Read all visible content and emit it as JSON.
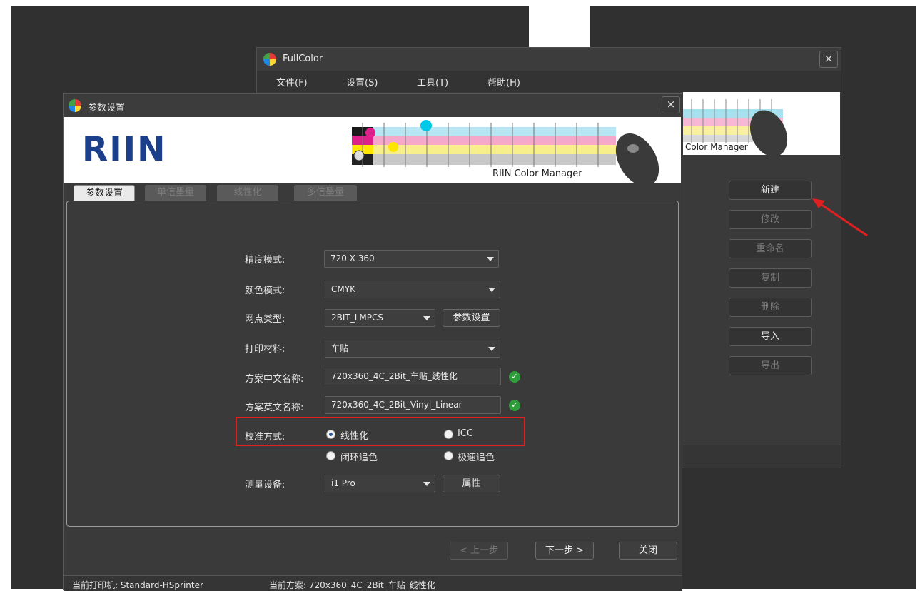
{
  "fullcolor": {
    "title": "FullColor",
    "close": "×",
    "menu": [
      "文件(F)",
      "设置(S)",
      "工具(T)",
      "帮助(H)"
    ],
    "banner_caption": "Color Manager",
    "buttons": [
      "新建",
      "修改",
      "重命名",
      "复制",
      "删除",
      "导入",
      "导出"
    ]
  },
  "dialog": {
    "title": "参数设置",
    "close": "×",
    "logo": "RIIN",
    "banner_caption": "RIIN Color Manager",
    "tabs": [
      "参数设置",
      "单信墨量",
      "线性化",
      "多信墨量"
    ],
    "form": {
      "resolution_label": "精度模式:",
      "resolution_value": "720 X 360",
      "color_mode_label": "颜色模式:",
      "color_mode_value": "CMYK",
      "dot_type_label": "网点类型:",
      "dot_type_value": "2BIT_LMPCS",
      "dot_params_button": "参数设置",
      "media_label": "打印材料:",
      "media_value": "车贴",
      "cn_name_label": "方案中文名称:",
      "cn_name_value": "720x360_4C_2Bit_车贴_线性化",
      "en_name_label": "方案英文名称:",
      "en_name_value": "720x360_4C_2Bit_Vinyl_Linear",
      "calib_label": "校准方式:",
      "calib_options": [
        "线性化",
        "ICC",
        "闭环追色",
        "极速追色"
      ],
      "device_label": "测量设备:",
      "device_value": "i1 Pro",
      "device_props_button": "属性"
    },
    "nav": {
      "prev": "< 上一步",
      "next": "下一步 >",
      "close": "关闭"
    },
    "status": {
      "printer": "当前打印机: Standard-HSprinter",
      "scheme": "当前方案: 720x360_4C_2Bit_车贴_线性化"
    }
  },
  "colors": {
    "accent_red": "#e02020",
    "logo_blue": "#1b3f8b",
    "check_green": "#2e9e3a"
  }
}
